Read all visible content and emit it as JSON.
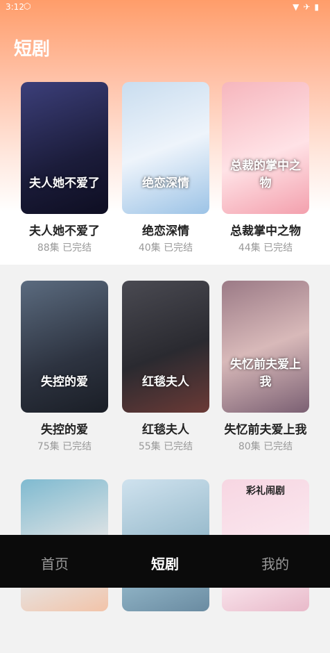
{
  "status": {
    "time": "3:12",
    "icons": [
      "wifi-icon",
      "airplane-icon",
      "battery-icon"
    ]
  },
  "page_title": "短剧",
  "colors": {
    "header_top": "#ff9d6a",
    "tabbar_bg": "#0b0b0b",
    "active_tab": "#ffffff",
    "inactive_tab": "#999999"
  },
  "dramas": [
    {
      "title": "夫人她不爱了",
      "episodes": "88集",
      "status": "已完结",
      "poster_text": "夫人她不爱了"
    },
    {
      "title": "绝恋深情",
      "episodes": "40集",
      "status": "已完结",
      "poster_text": "绝恋深情"
    },
    {
      "title": "总裁掌中之物",
      "episodes": "44集",
      "status": "已完结",
      "poster_text": "总裁的掌中之物"
    },
    {
      "title": "失控的爱",
      "episodes": "75集",
      "status": "已完结",
      "poster_text": "失控的爱"
    },
    {
      "title": "红毯夫人",
      "episodes": "55集",
      "status": "已完结",
      "poster_text": "红毯夫人"
    },
    {
      "title": "失忆前夫爱上我",
      "episodes": "80集",
      "status": "已完结",
      "poster_text": "失忆前夫爱上我"
    },
    {
      "title": "",
      "episodes": "",
      "status": "",
      "poster_text": ""
    },
    {
      "title": "",
      "episodes": "",
      "status": "",
      "poster_text": ""
    },
    {
      "title": "",
      "episodes": "",
      "status": "",
      "poster_text": "彩礼闹剧"
    }
  ],
  "tabs": [
    {
      "label": "首页"
    },
    {
      "label": "短剧"
    },
    {
      "label": "我的"
    }
  ]
}
